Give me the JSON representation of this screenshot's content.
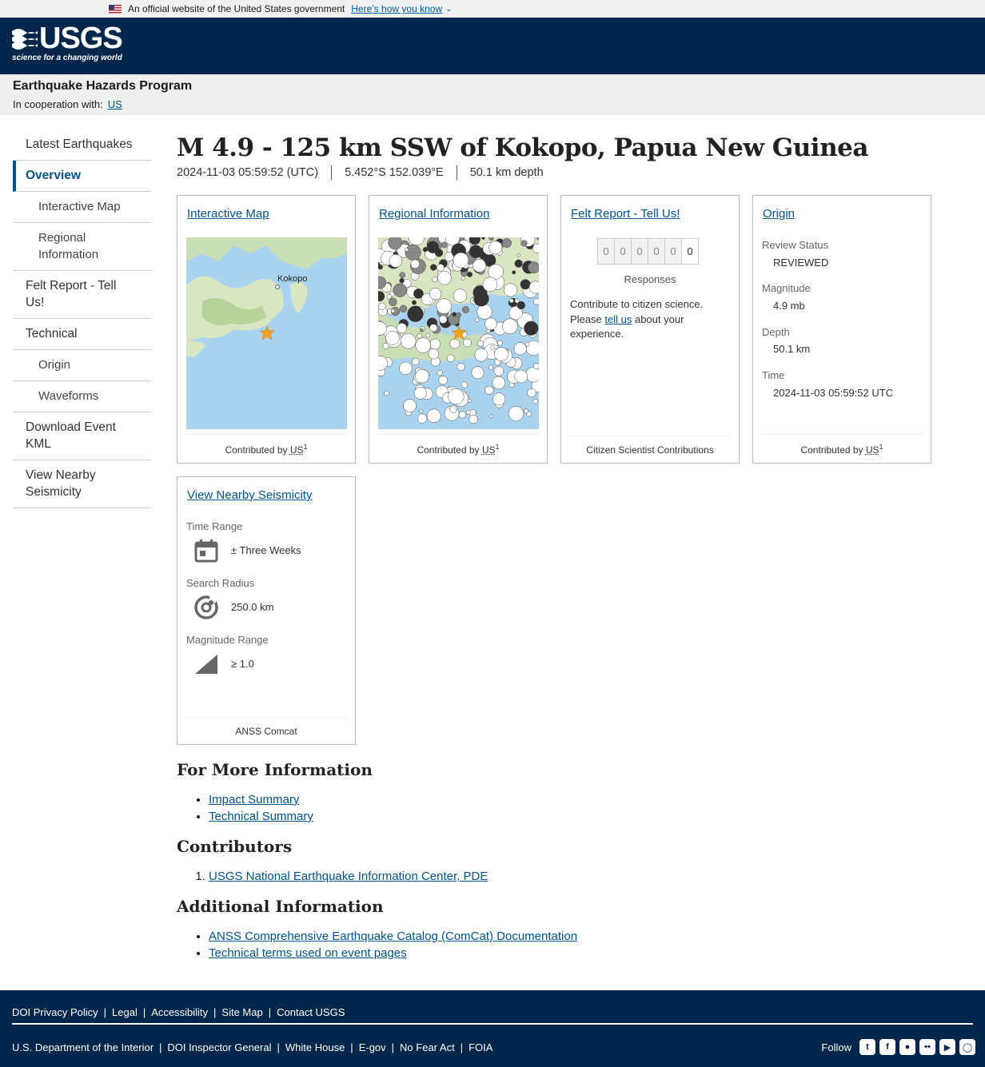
{
  "gov_banner": {
    "text": "An official website of the United States government",
    "link": "Here’s how you know"
  },
  "header": {
    "logo_word": "USGS",
    "logo_tagline": "science for a changing world"
  },
  "program": {
    "title": "Earthquake Hazards Program",
    "coop_label": "In cooperation with:",
    "coop_link": "US"
  },
  "sidebar": {
    "items": [
      {
        "label": "Latest Earthquakes"
      },
      {
        "label": "Overview"
      },
      {
        "label": "Interactive Map"
      },
      {
        "label": "Regional Information"
      },
      {
        "label": "Felt Report - Tell Us!"
      },
      {
        "label": "Technical"
      },
      {
        "label": "Origin"
      },
      {
        "label": "Waveforms"
      },
      {
        "label": "Download Event KML"
      },
      {
        "label": "View Nearby Seismicity"
      }
    ]
  },
  "event": {
    "title": "M 4.9 - 125 km SSW of Kokopo, Papua New Guinea",
    "time": "2024-11-03 05:59:52 (UTC)",
    "location": "5.452°S 152.039°E",
    "depth": "50.1 km depth"
  },
  "cards": {
    "map": {
      "title": "Interactive Map",
      "city_label": "Kokopo",
      "footer_prefix": "Contributed by",
      "footer_abbr": "US",
      "footer_sup": "1"
    },
    "regional": {
      "title": "Regional Information",
      "footer_prefix": "Contributed by",
      "footer_abbr": "US",
      "footer_sup": "1"
    },
    "felt": {
      "title": "Felt Report - Tell Us!",
      "digits": [
        "0",
        "0",
        "0",
        "0",
        "0",
        "0"
      ],
      "responses_label": "Responses",
      "contrib_text_1": "Contribute to citizen science. Please",
      "contrib_link": "tell us",
      "contrib_text_2": "about your experience.",
      "footer": "Citizen Scientist Contributions"
    },
    "origin": {
      "title": "Origin",
      "review_label": "Review Status",
      "review_value": "REVIEWED",
      "magnitude_label": "Magnitude",
      "magnitude_value": "4.9 mb",
      "depth_label": "Depth",
      "depth_value": "50.1 km",
      "time_label": "Time",
      "time_value": "2024-11-03 05:59:52 UTC",
      "footer_prefix": "Contributed by",
      "footer_abbr": "US",
      "footer_sup": "1"
    },
    "seismicity": {
      "title": "View Nearby Seismicity",
      "time_label": "Time Range",
      "time_value": "± Three Weeks",
      "radius_label": "Search Radius",
      "radius_value": "250.0 km",
      "mag_label": "Magnitude Range",
      "mag_value": "≥ 1.0",
      "footer": "ANSS Comcat"
    }
  },
  "more_info": {
    "heading": "For More Information",
    "links": [
      "Impact Summary",
      "Technical Summary"
    ]
  },
  "contributors": {
    "heading": "Contributors",
    "items": [
      "USGS National Earthquake Information Center, PDE"
    ]
  },
  "additional": {
    "heading": "Additional Information",
    "links": [
      "ANSS Comprehensive Earthquake Catalog (ComCat) Documentation",
      "Technical terms used on event pages"
    ]
  },
  "footer": {
    "row1": [
      "DOI Privacy Policy",
      "Legal",
      "Accessibility",
      "Site Map",
      "Contact USGS"
    ],
    "row2": [
      "U.S. Department of the Interior",
      "DOI Inspector General",
      "White House",
      "E-gov",
      "No Fear Act",
      "FOIA"
    ],
    "follow_label": "Follow",
    "social_icons": [
      "twitter-icon",
      "facebook-icon",
      "github-icon",
      "flickr-icon",
      "youtube-icon",
      "instagram-icon"
    ]
  }
}
